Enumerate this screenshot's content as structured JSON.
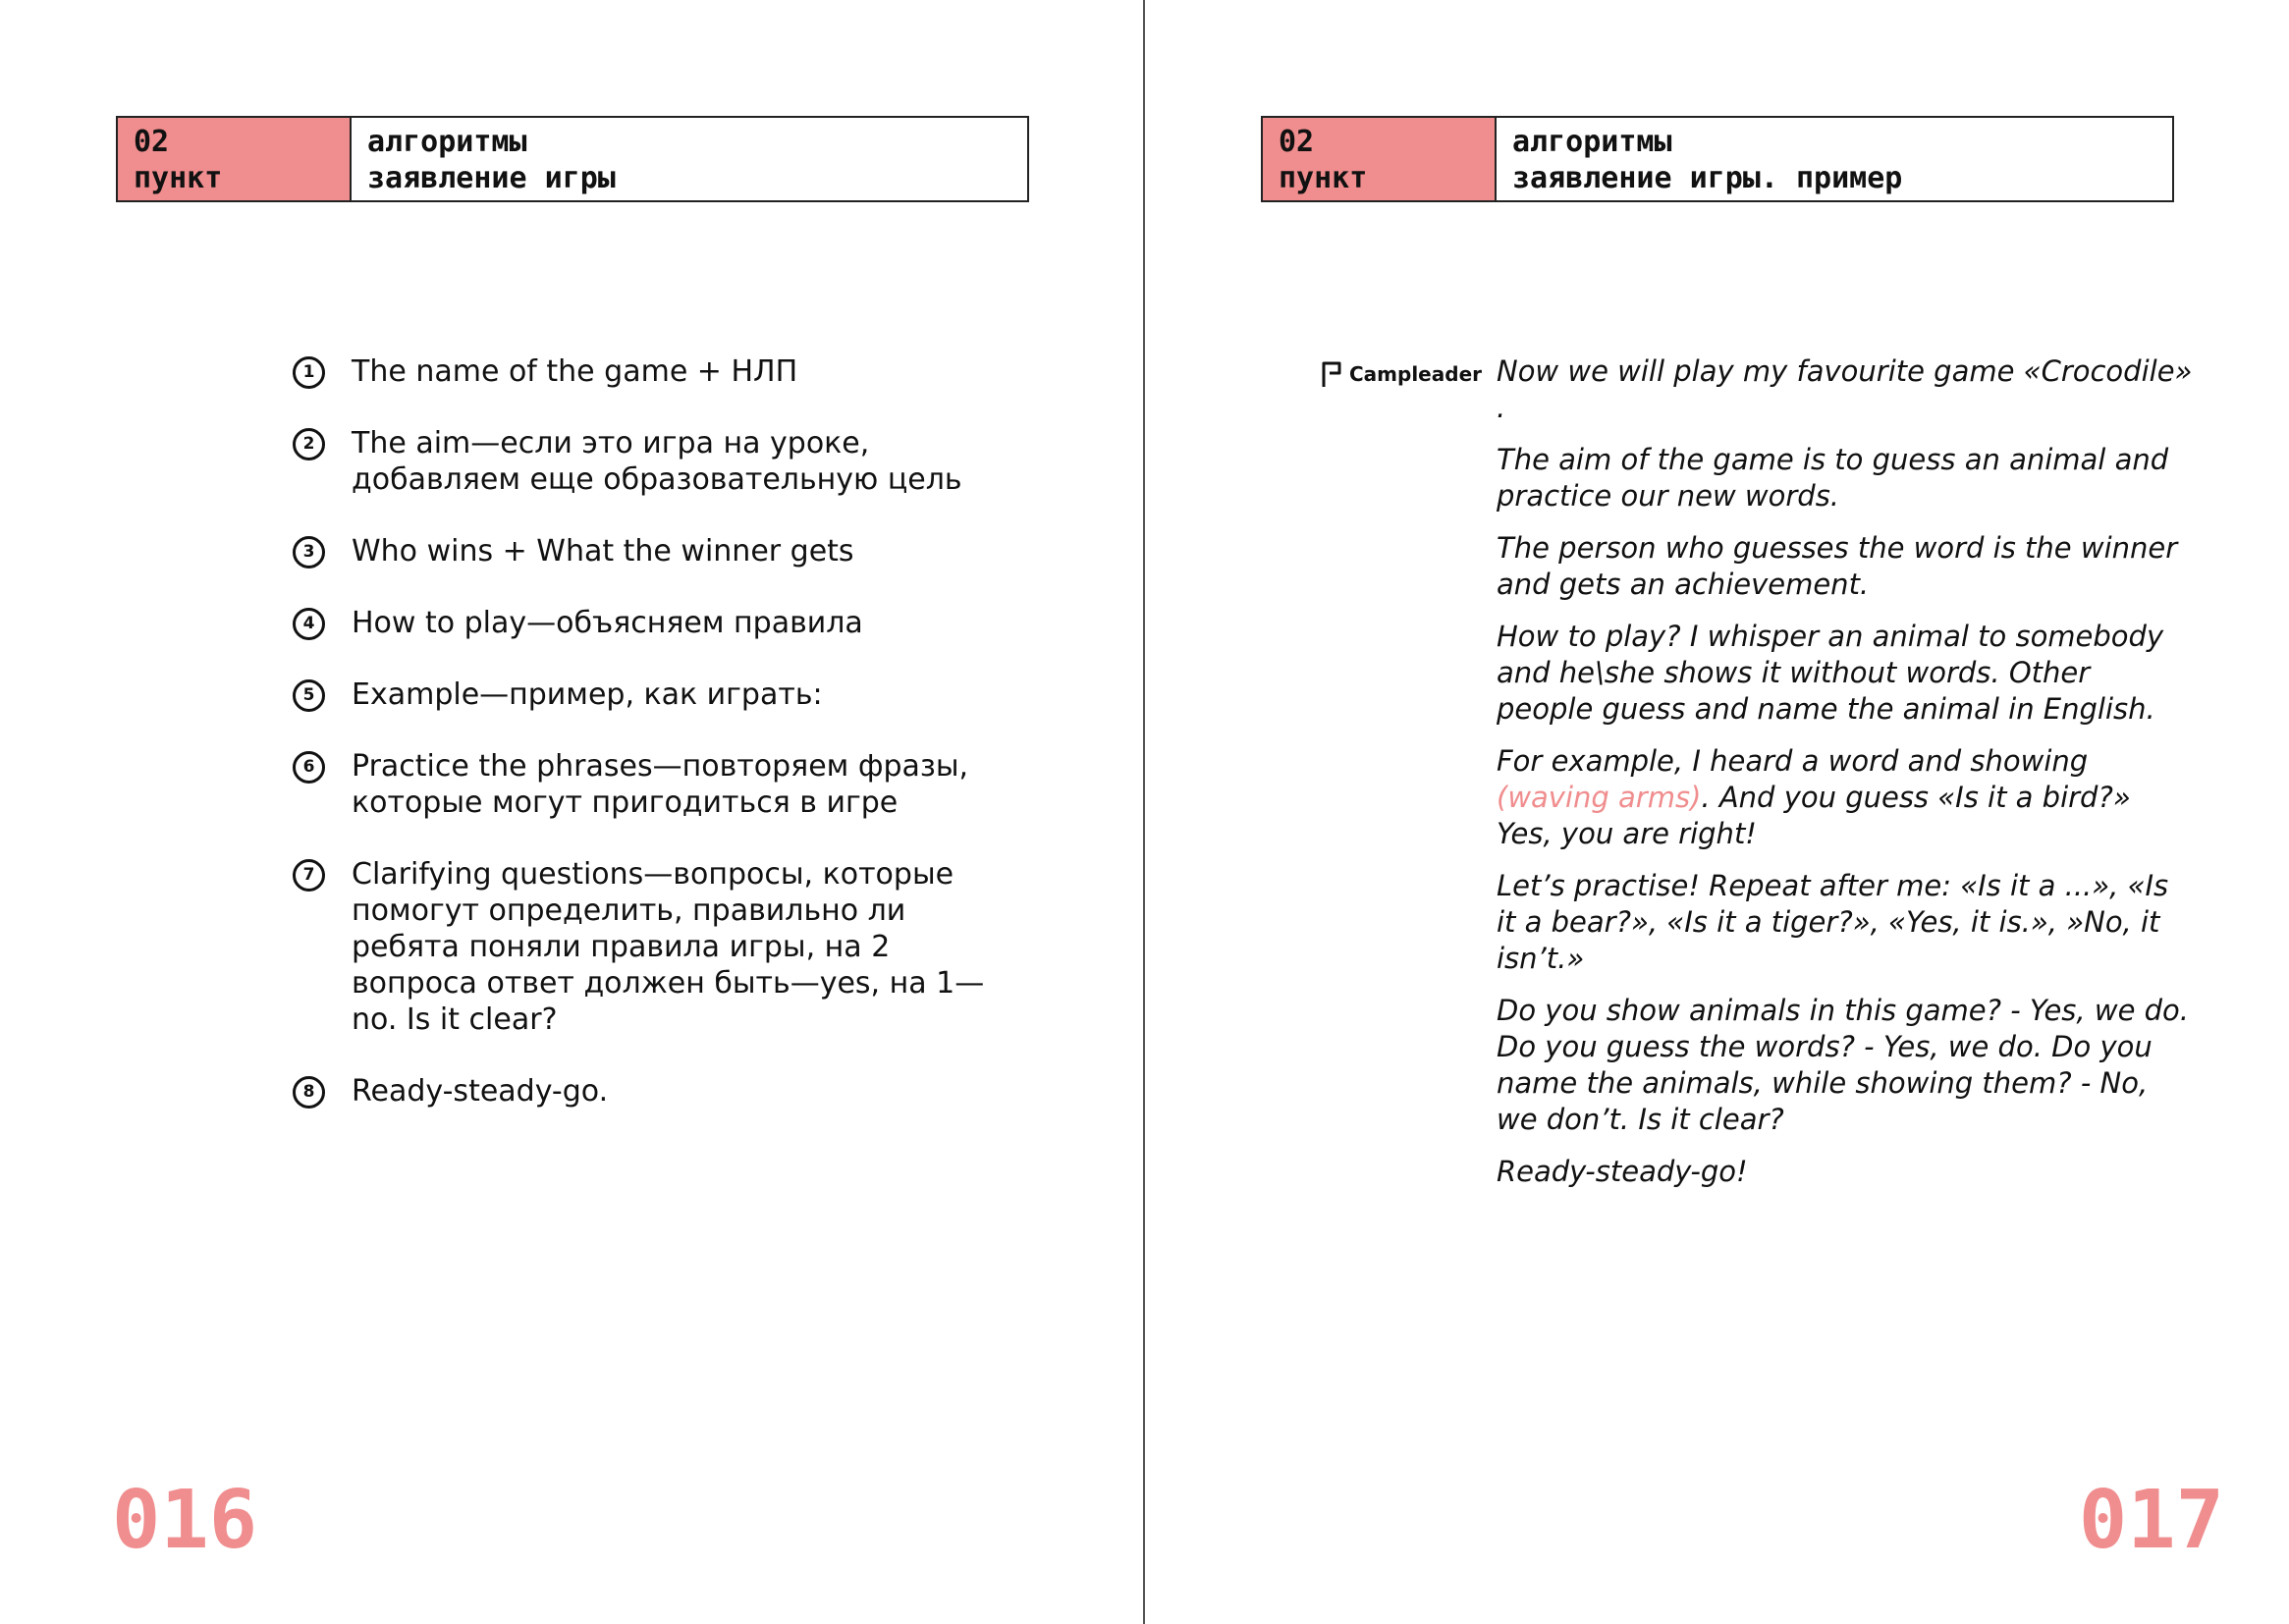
{
  "left_page": {
    "header": {
      "section_number": "02",
      "section_label": "пункт",
      "title_line1": "алгоритмы",
      "title_line2": "заявление игры"
    },
    "steps": [
      {
        "num": "1",
        "text": "The name of the game + НЛП"
      },
      {
        "num": "2",
        "text": "The aim—если это игра на уроке, добавляем еще образовательную цель"
      },
      {
        "num": "3",
        "text": "Who wins + What the winner gets"
      },
      {
        "num": "4",
        "text": "How to play—объясняем правила"
      },
      {
        "num": "5",
        "text": "Example—пример, как играть:"
      },
      {
        "num": "6",
        "text": "Practice the phrases—повторяем фразы, которые могут пригодиться в игре"
      },
      {
        "num": "7",
        "text": "Clarifying questions—вопросы, которые помогут определить, правильно ли ребята поняли правила игры, на 2 вопроса ответ должен быть—yes, на 1—no. Is it clear?"
      },
      {
        "num": "8",
        "text": "Ready-steady-go."
      }
    ],
    "page_number": "016"
  },
  "right_page": {
    "header": {
      "section_number": "02",
      "section_label": "пункт",
      "title_line1": "алгоритмы",
      "title_line2": "заявление игры. пример"
    },
    "speaker": {
      "icon": "flag-icon",
      "label": "Campleader"
    },
    "paragraphs": [
      "Now we will play my favourite game «Crocodile» .",
      "The aim of the game is to guess an animal and practice our new words.",
      "The person who guesses the word is the winner and gets an achievement.",
      "How to play? I whisper an animal to somebody and he\\she shows it without words. Other people guess and name the animal in English.",
      {
        "before": "For example, I heard a word and showing ",
        "accent": "(waving arms)",
        "after": ". And you guess «Is it a bird?» Yes, you are right!"
      },
      "Let’s practise! Repeat after me: «Is it a ...», «Is it a bear?», «Is it a tiger?», «Yes, it is.», »No, it isn’t.»",
      "Do you show animals in this game? - Yes, we do. Do you guess the words? - Yes, we do. Do you name the animals, while showing them? - No, we don’t. Is it clear?",
      "Ready-steady-go!"
    ],
    "page_number": "017"
  },
  "colors": {
    "accent": "#f08d8e",
    "text": "#111111",
    "rule": "#555555"
  }
}
